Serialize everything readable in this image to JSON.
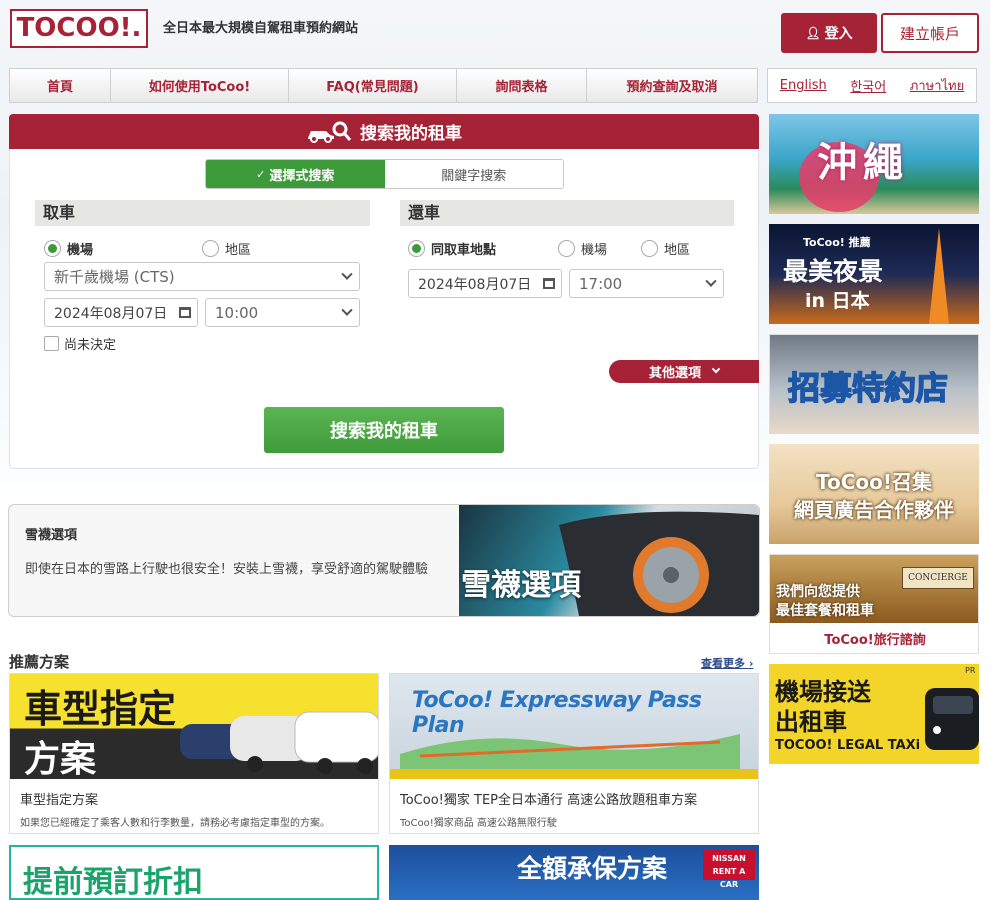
{
  "header": {
    "logo_text": "TOCOO!.",
    "tagline": "全日本最大規模自駕租車預約網站",
    "login_label": "登入",
    "signup_label": "建立帳戶"
  },
  "nav": {
    "items": [
      {
        "label": "首頁"
      },
      {
        "label": "如何使用ToCoo!"
      },
      {
        "label": "FAQ(常見問題)"
      },
      {
        "label": "詢問表格"
      },
      {
        "label": "預約查詢及取消"
      }
    ]
  },
  "languages": [
    "English",
    "한국어",
    "ภาษาไทย"
  ],
  "search": {
    "title": "搜索我的租車",
    "tab_selected": "選擇式搜索",
    "tab_keyword": "關鍵字搜索",
    "pickup": {
      "title": "取車",
      "radio_airport": "機場",
      "radio_area": "地區",
      "location_value": "新千歲機場 (CTS)",
      "date_value": "2024年08月07日",
      "time_value": "10:00",
      "undecided_label": "尚未決定"
    },
    "return": {
      "title": "還車",
      "radio_same": "同取車地點",
      "radio_airport": "機場",
      "radio_area": "地區",
      "date_value": "2024年08月07日",
      "time_value": "17:00"
    },
    "other_options_label": "其他選項",
    "search_button_label": "搜索我的租車"
  },
  "snow_chain": {
    "title": "雪襪選項",
    "description": "即使在日本的雪路上行駛也很安全！安裝上雪襪，享受舒適的駕駛體驗",
    "image_text": "雪襪選項"
  },
  "recommended": {
    "title": "推薦方案",
    "more_label": "查看更多",
    "cards": [
      {
        "image_line1": "車型指定",
        "image_line2": "方案",
        "name": "車型指定方案",
        "sub": "如果您已經確定了乘客人數和行李數量，請務必考慮指定車型的方案。"
      },
      {
        "image_text": "ToCoo! Expressway Pass Plan",
        "name": "ToCoo!獨家 TEP全日本通行 高速公路放題租車方案",
        "sub": "ToCoo!獨家商品 高速公路無限行駛"
      },
      {
        "image_text": "提前預訂折扣"
      },
      {
        "image_text": "全額承保方案",
        "badge_line1": "NISSAN",
        "badge_line2": "RENT A CAR"
      }
    ]
  },
  "side_banners": [
    {
      "text": "沖繩"
    },
    {
      "line1": "ToCoo! 推薦",
      "line2": "最美夜景",
      "line3": "in 日本"
    },
    {
      "text": "招募特約店"
    },
    {
      "line1": "ToCoo!召集",
      "line2": "網頁廣告合作夥伴"
    },
    {
      "sign": "CONCIERGE",
      "line1": "我們向您提供",
      "line2": "最佳套餐和租車",
      "caption": "ToCoo!旅行諮詢"
    },
    {
      "line1": "機場接送",
      "line2": "出租車",
      "line3": "TOCOO! LEGAL TAXi",
      "tag": "PR"
    }
  ]
}
